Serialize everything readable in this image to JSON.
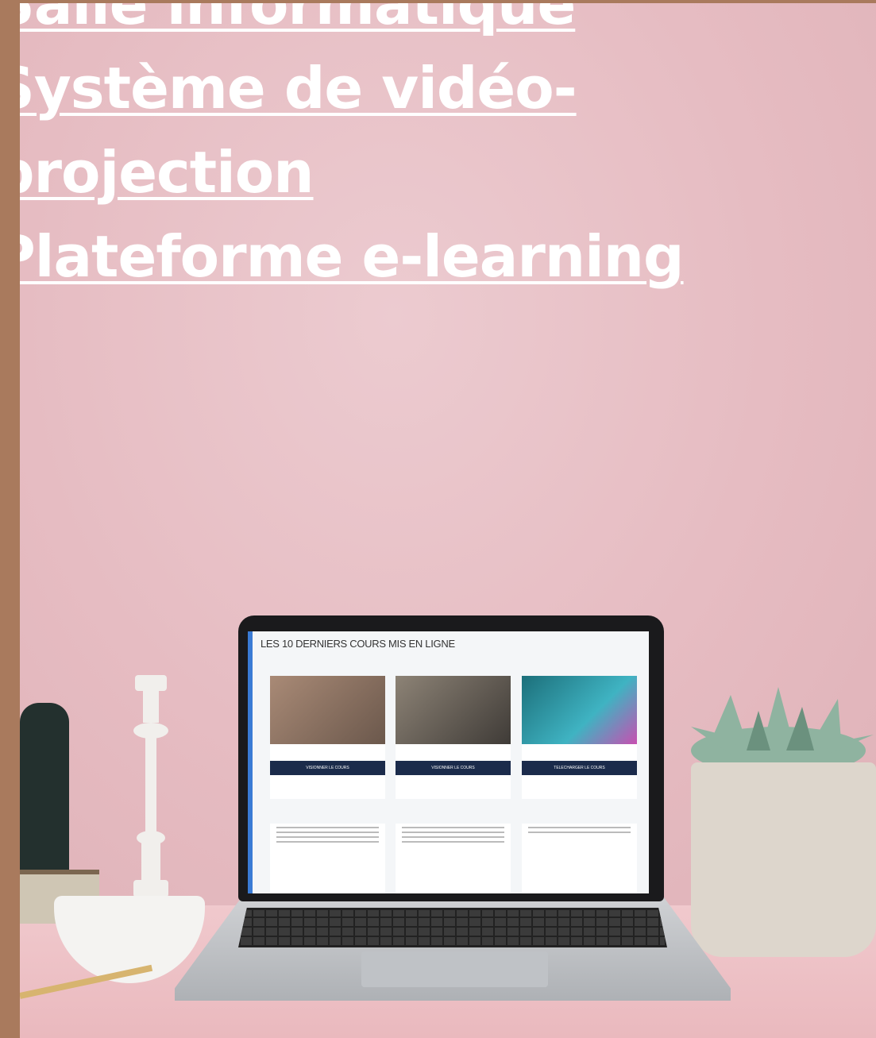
{
  "headings": [
    "Salle informatique",
    "Système de vidéo-",
    "projection",
    "Plateforme e-learning"
  ],
  "laptop_screen": {
    "title": "LES 10 DERNIERS COURS MIS EN LIGNE",
    "cards": [
      {
        "button": "VISIONNER LE COURS"
      },
      {
        "button": "VISIONNER LE COURS"
      },
      {
        "button": "TELECHARGER LE COURS"
      }
    ]
  },
  "colors": {
    "wall": "#e6bcc2",
    "accent_bar": "#a97a5d",
    "heading_text": "#ffffff",
    "screen_button": "#1b2b4b"
  }
}
